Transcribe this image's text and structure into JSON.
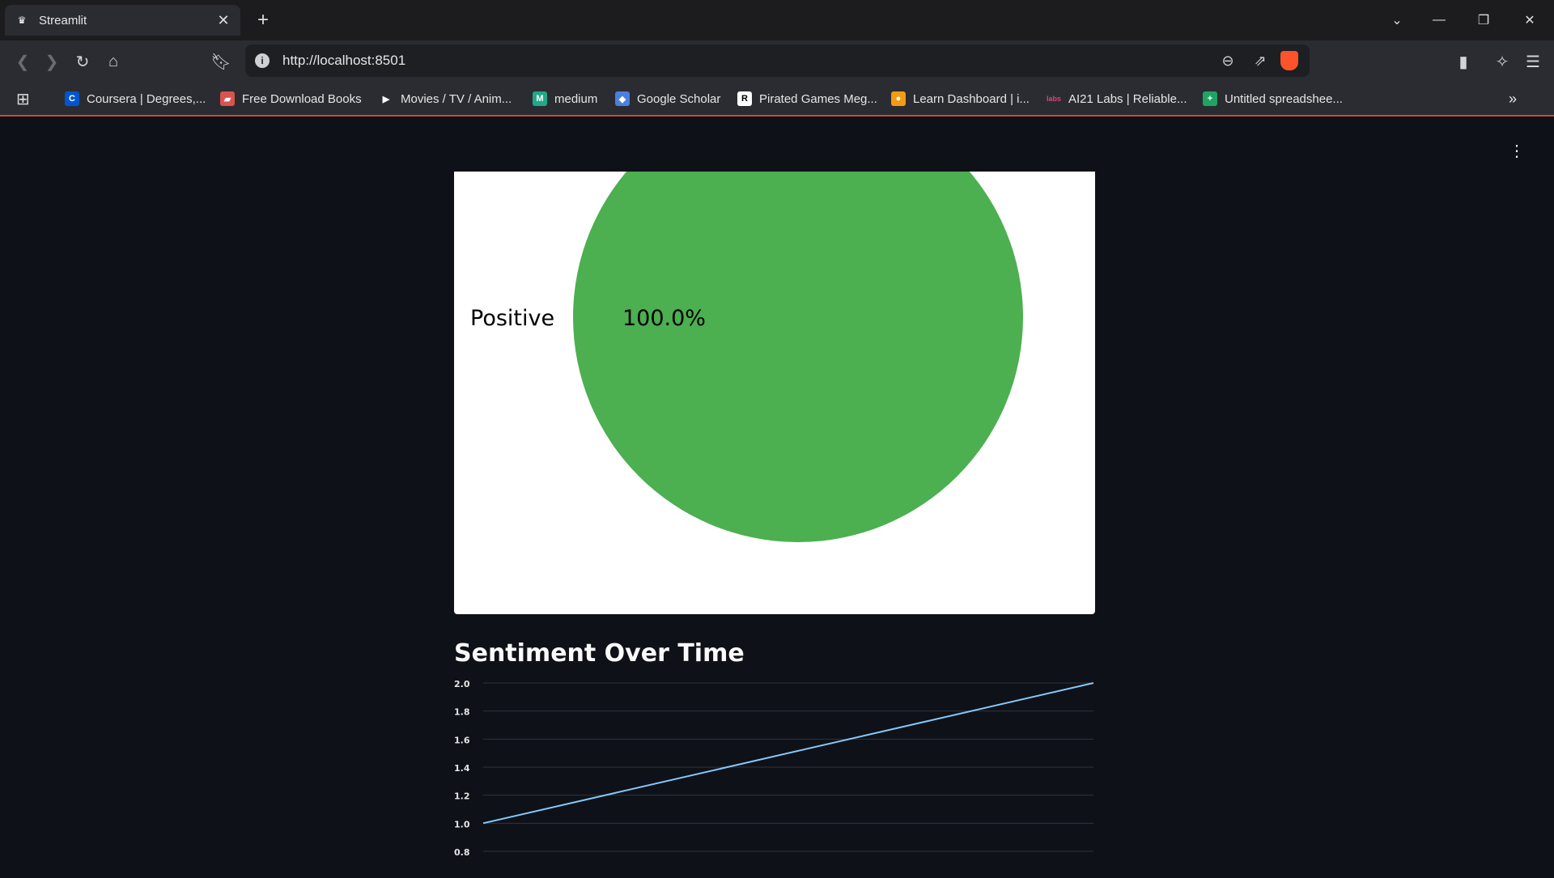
{
  "browser": {
    "tab_title": "Streamlit",
    "tab_favicon": "streamlit-crown-icon",
    "url": "http://localhost:8501",
    "bookmarks": [
      {
        "label": "Coursera | Degrees,...",
        "icon": "coursera-icon",
        "color": "#0056d2",
        "glyph": "C"
      },
      {
        "label": "Free Download Books",
        "icon": "book-icon",
        "color": "#d9534f",
        "glyph": "▰"
      },
      {
        "label": "Movies / TV / Anim...",
        "icon": "play-icon",
        "color": "#2b2c31",
        "glyph": "▶"
      },
      {
        "label": "medium",
        "icon": "medium-icon",
        "color": "#1fa987",
        "glyph": "M"
      },
      {
        "label": "Google Scholar",
        "icon": "scholar-icon",
        "color": "#4a7fe0",
        "glyph": "◆"
      },
      {
        "label": "Pirated Games Meg...",
        "icon": "r-icon",
        "color": "#ffffff",
        "glyph": "R"
      },
      {
        "label": "Learn Dashboard | i...",
        "icon": "learn-icon",
        "color": "#f39c12",
        "glyph": "●"
      },
      {
        "label": "AI21 Labs | Reliable...",
        "icon": "labs-icon",
        "color": "#e0407f",
        "glyph": "labs"
      },
      {
        "label": "Untitled spreadshee...",
        "icon": "sheets-icon",
        "color": "#1fa463",
        "glyph": "+"
      }
    ]
  },
  "pie_chart": {
    "labels": [
      "Positive"
    ],
    "values": [
      100
    ],
    "pct_labels": [
      "100.0%"
    ],
    "colors": [
      "#4caf50"
    ]
  },
  "section_title": "Sentiment Over Time",
  "chart_data": {
    "type": "line",
    "x": [
      0,
      1
    ],
    "series": [
      {
        "values": [
          1.0,
          2.0
        ],
        "color": "#83c9ff"
      }
    ],
    "yticks": [
      "2.0",
      "1.8",
      "1.6",
      "1.4",
      "1.2",
      "1.0",
      "0.8"
    ],
    "ylim": [
      0.8,
      2.0
    ],
    "grid": true
  }
}
